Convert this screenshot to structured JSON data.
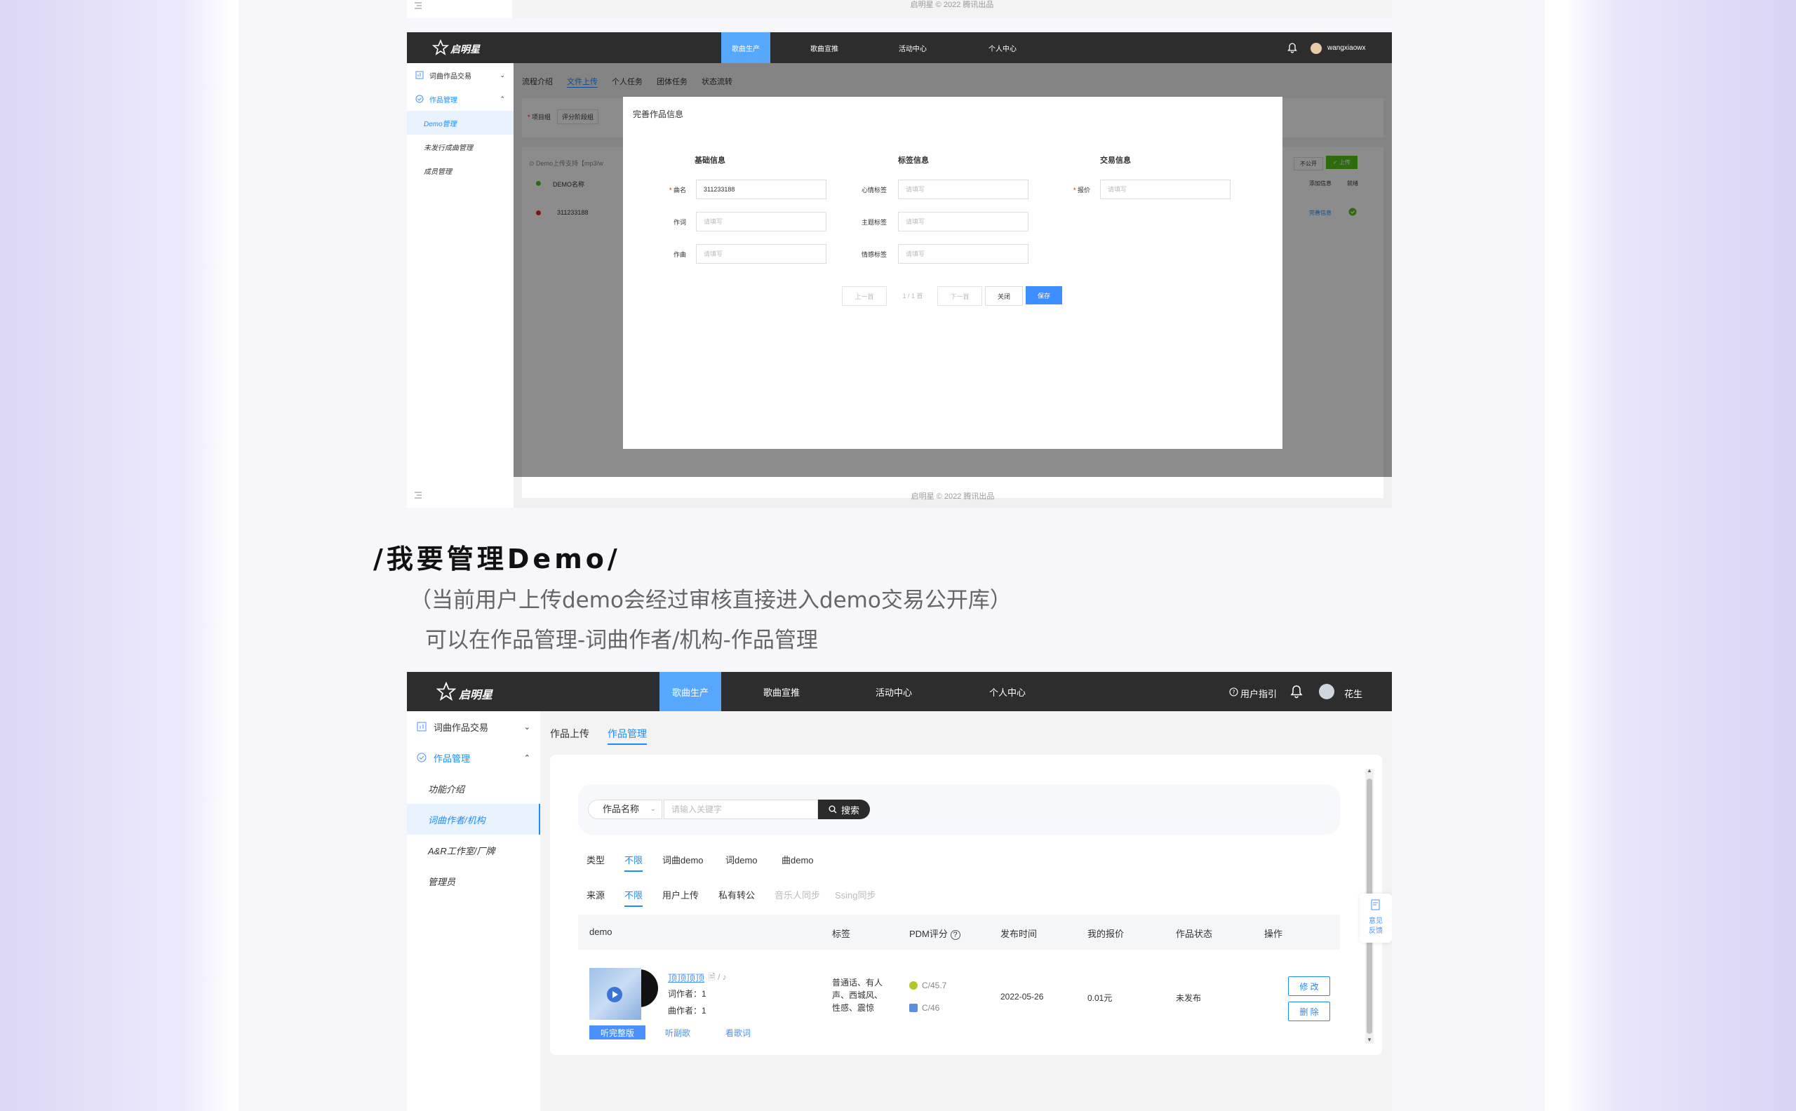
{
  "colors": {
    "accent": "#1e8cff",
    "nav_bg": "#2d2d2d",
    "nav_active": "#56a8ff",
    "primary_btn": "#3d8fff",
    "upload_green": "#52c41a"
  },
  "top_strip": {
    "footer": "启明星 © 2022 腾讯出品"
  },
  "screen1": {
    "logo": "启明星",
    "nav": [
      "歌曲生产",
      "歌曲宣推",
      "活动中心",
      "个人中心"
    ],
    "user": "wangxiaowx",
    "sidebar": {
      "group1": "词曲作品交易",
      "group2": "作品管理",
      "items": [
        "Demo管理",
        "未发行成曲管理",
        "成员管理"
      ]
    },
    "tabs": [
      "流程介绍",
      "文件上传",
      "个人任务",
      "团体任务",
      "状态流转"
    ],
    "filter_labels": [
      "项目组",
      "评分阶段组"
    ],
    "notice": "Demo上传支持【mp3/w",
    "table_header": "DEMO名称",
    "table_row": "311233188",
    "right_header_1": "添加信息",
    "right_header_2": "就绪",
    "right_link": "完善信息",
    "right_btn_private": "不公开",
    "right_btn_upload": "上传",
    "footer": "启明星 © 2022 腾讯出品",
    "modal": {
      "title": "完善作品信息",
      "sections": [
        "基础信息",
        "标签信息",
        "交易信息"
      ],
      "basic": {
        "name_label": "曲名",
        "name_value": "311233188",
        "lyric_label": "作词",
        "lyric_placeholder": "请填写",
        "music_label": "作曲",
        "music_placeholder": "请填写"
      },
      "tags": {
        "mood_label": "心情标签",
        "mood_placeholder": "请填写",
        "theme_label": "主题标签",
        "theme_placeholder": "请填写",
        "emotion_label": "情感标签",
        "emotion_placeholder": "请填写"
      },
      "trade": {
        "price_label": "报价",
        "price_placeholder": "请填写"
      },
      "buttons": {
        "prev": "上一首",
        "page": "1 / 1 首",
        "next": "下一首",
        "close": "关闭",
        "save": "保存"
      }
    }
  },
  "section": {
    "heading": "/我要管理Demo/",
    "line1": "（当前用户上传demo会经过审核直接进入demo交易公开库）",
    "line2": "可以在作品管理-词曲作者/机构-作品管理"
  },
  "screen2": {
    "logo": "启明星",
    "nav": [
      "歌曲生产",
      "歌曲宣推",
      "活动中心",
      "个人中心"
    ],
    "guide": "用户指引",
    "user": "花生",
    "sidebar": {
      "group1": "词曲作品交易",
      "group2": "作品管理",
      "items": [
        "功能介绍",
        "词曲作者/机构",
        "A&R工作室/厂牌",
        "管理员"
      ]
    },
    "tabs": [
      "作品上传",
      "作品管理"
    ],
    "search": {
      "select": "作品名称",
      "placeholder": "请输入关键字",
      "button": "搜索"
    },
    "filter_type": {
      "label": "类型",
      "options": [
        "不限",
        "词曲demo",
        "词demo",
        "曲demo"
      ]
    },
    "filter_source": {
      "label": "来源",
      "options": [
        "不限",
        "用户上传",
        "私有转公",
        "音乐人同步",
        "Ssing同步"
      ]
    },
    "table_headers": [
      "demo",
      "标签",
      "PDM评分",
      "发布时间",
      "我的报价",
      "作品状态",
      "操作"
    ],
    "row": {
      "title": "顶顶顶顶",
      "lyricist": "词作者：1",
      "composer": "曲作者：1",
      "actions_media": [
        "听完整版",
        "听副歌",
        "看歌词"
      ],
      "tags": [
        "普通话、有人",
        "声、西城风、",
        "性感、震惊"
      ],
      "pdm": [
        "C/45.7",
        "C/46"
      ],
      "date": "2022-05-26",
      "price": "0.01元",
      "status": "未发布",
      "ops": [
        "修 改",
        "删 除"
      ]
    },
    "feedback": [
      "意见",
      "反馈"
    ]
  }
}
